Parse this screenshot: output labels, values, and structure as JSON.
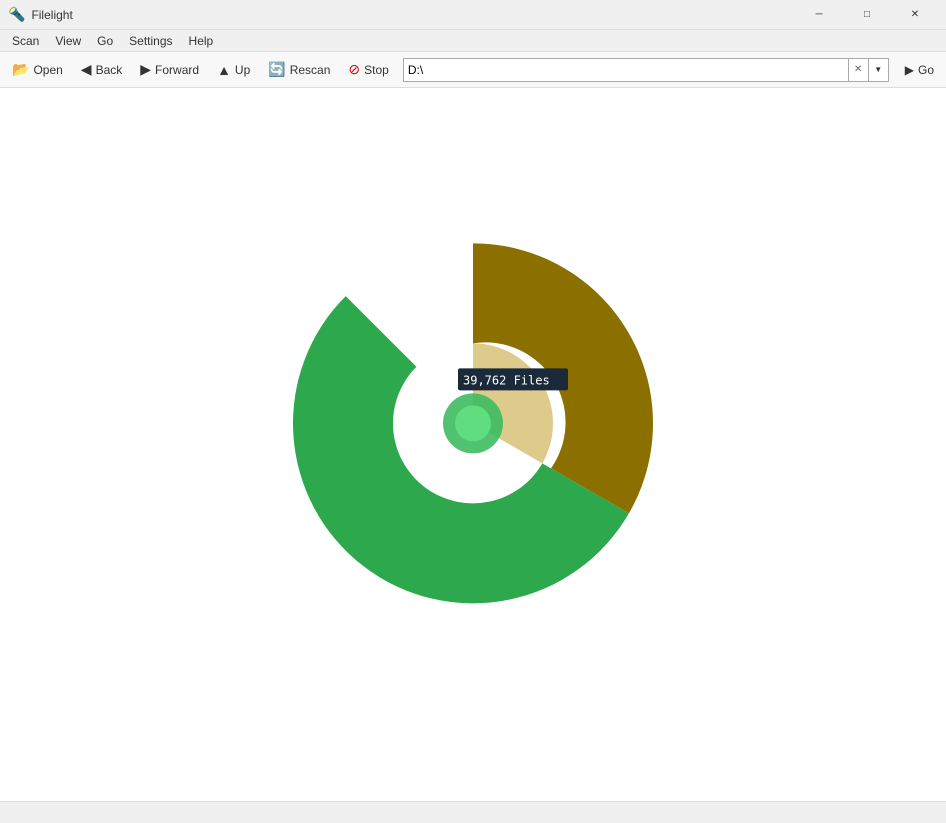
{
  "app": {
    "title": "Filelight",
    "icon_symbol": "🔦"
  },
  "titlebar": {
    "minimize_label": "─",
    "maximize_label": "□",
    "close_label": "✕"
  },
  "menubar": {
    "items": [
      {
        "id": "scan",
        "label": "Scan"
      },
      {
        "id": "view",
        "label": "View"
      },
      {
        "id": "go",
        "label": "Go"
      },
      {
        "id": "settings",
        "label": "Settings"
      },
      {
        "id": "help",
        "label": "Help"
      }
    ]
  },
  "toolbar": {
    "open_label": "Open",
    "back_label": "Back",
    "forward_label": "Forward",
    "up_label": "Up",
    "rescan_label": "Rescan",
    "stop_label": "Stop",
    "go_label": "Go"
  },
  "addressbar": {
    "value": "D:\\"
  },
  "chart": {
    "tooltip_text": "39,762 Files",
    "segments": [
      {
        "id": "olive",
        "color": "#8B7000",
        "start_angle": -90,
        "end_angle": 90,
        "inner_radius": 80,
        "outer_radius": 180
      },
      {
        "id": "green_light",
        "color": "#2EA84C",
        "start_angle": 90,
        "end_angle": 260,
        "inner_radius": 80,
        "outer_radius": 180
      }
    ],
    "center": {
      "inner_color": "#3DBB60",
      "outer_color": "#C8A840",
      "radius": 80
    }
  },
  "statusbar": {
    "text": ""
  }
}
